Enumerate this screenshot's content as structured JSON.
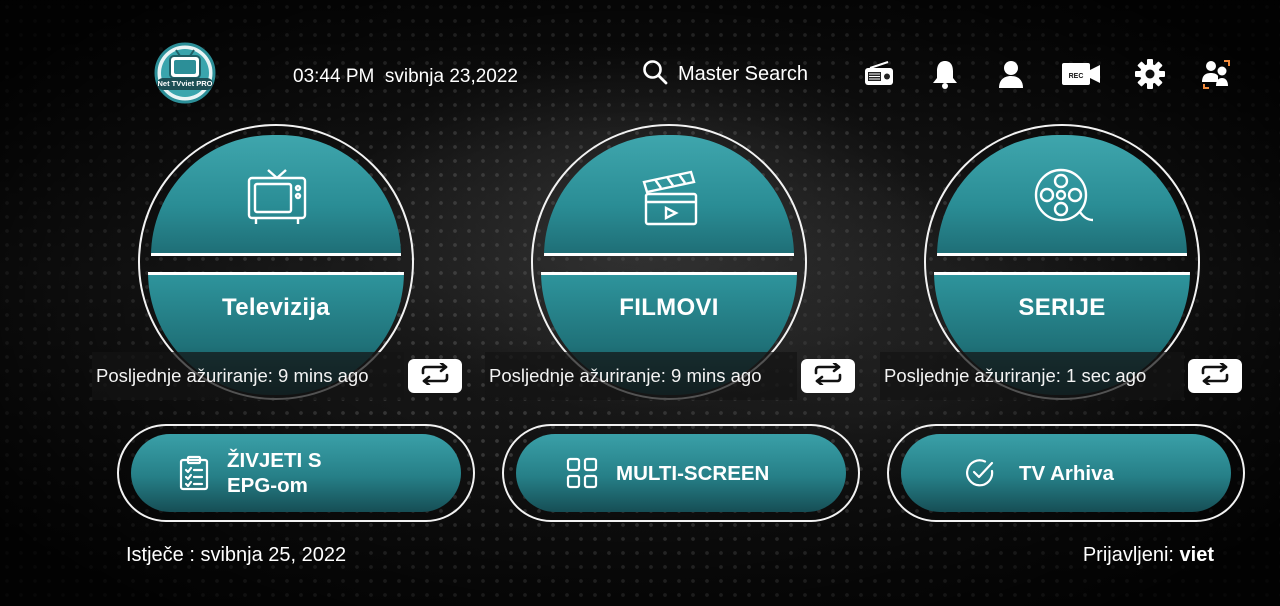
{
  "app": {
    "logo_text": "Net TVviet PRO"
  },
  "header": {
    "time": "03:44 PM",
    "date": "svibnja 23,2022",
    "search_label": "Master Search",
    "icons": [
      "radio-icon",
      "bell-icon",
      "user-icon",
      "rec-icon",
      "gear-icon",
      "switch-user-icon"
    ],
    "rec_label": "REC"
  },
  "cards": [
    {
      "title": "Televizija",
      "update": "Posljednje ažuriranje: 9 mins ago",
      "icon": "tv-icon"
    },
    {
      "title": "FILMOVI",
      "update": "Posljednje ažuriranje: 9 mins ago",
      "icon": "clapperboard-icon"
    },
    {
      "title": "SERIJE",
      "update": "Posljednje ažuriranje: 1 sec ago",
      "icon": "film-reel-icon"
    }
  ],
  "pills": [
    {
      "line1": "ŽIVJETI S",
      "line2": "EPG-om",
      "icon": "checklist-icon"
    },
    {
      "label": "MULTI-SCREEN",
      "icon": "grid-icon"
    },
    {
      "label": "TV Arhiva",
      "icon": "check-circle-icon"
    }
  ],
  "footer": {
    "expires": "Istječe : svibnja 25, 2022",
    "logged_in_label": "Prijavljeni:",
    "username": "viet"
  },
  "colors": {
    "accent": "#2a8d95",
    "ring": "#f2f2f2",
    "background": "#111111"
  }
}
